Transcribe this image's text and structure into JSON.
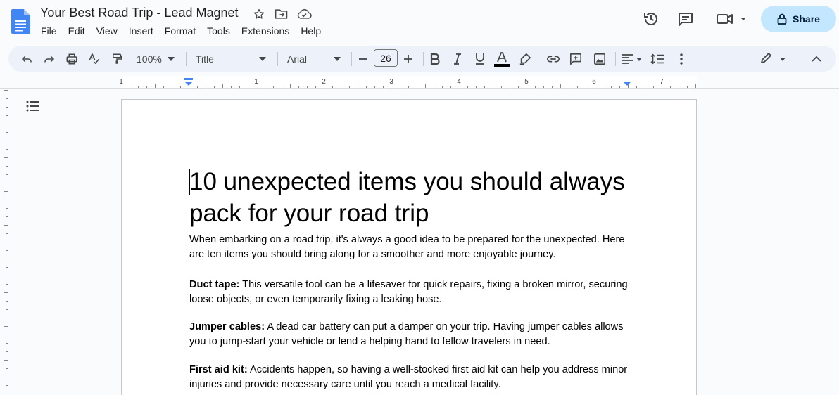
{
  "doc_title": "Your Best Road Trip - Lead Magnet",
  "menu": [
    "File",
    "Edit",
    "View",
    "Insert",
    "Format",
    "Tools",
    "Extensions",
    "Help"
  ],
  "share_label": "Share",
  "toolbar": {
    "zoom": "100%",
    "style": "Title",
    "font": "Arial",
    "font_size": "26",
    "text_color": "#000000"
  },
  "ruler_labels": [
    "1",
    "1",
    "2",
    "3",
    "4",
    "5",
    "6",
    "7"
  ],
  "accent": "#c2e7ff",
  "document": {
    "title": "10 unexpected items you should always pack for your road trip",
    "intro": "When embarking on a road trip, it's always a good idea to be prepared for the unexpected. Here are ten items you should bring along for a smoother and more enjoyable journey.",
    "items": [
      {
        "name": "Duct tape:",
        "text": " This versatile tool can be a lifesaver for quick repairs, fixing a broken mirror, securing loose objects, or even temporarily fixing a leaking hose."
      },
      {
        "name": "Jumper cables:",
        "text": " A dead car battery can put a damper on your trip. Having jumper cables allows you to jump-start your vehicle or lend a helping hand to fellow travelers in need."
      },
      {
        "name": "First aid kit:",
        "text": " Accidents happen, so having a well-stocked first aid kit can help you address minor injuries and provide necessary care until you reach a medical facility."
      }
    ]
  }
}
